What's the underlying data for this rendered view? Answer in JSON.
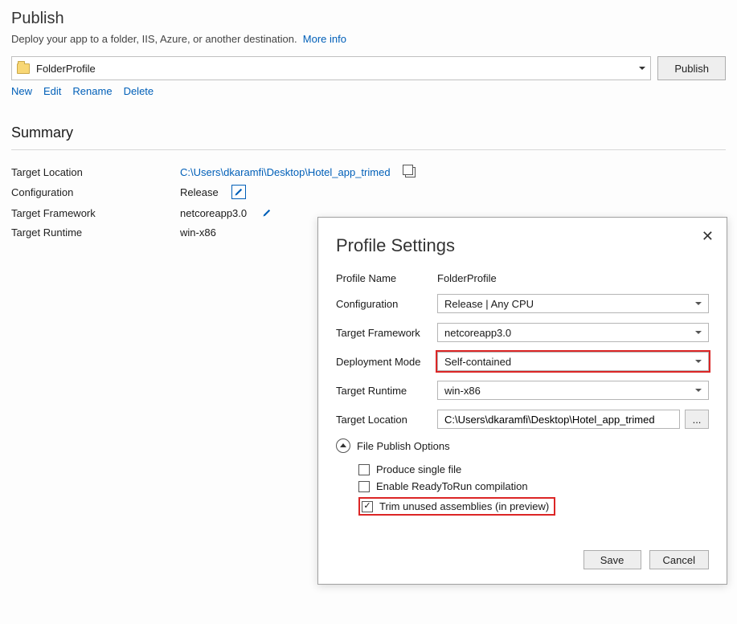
{
  "header": {
    "title": "Publish",
    "subtitle": "Deploy your app to a folder, IIS, Azure, or another destination.",
    "more_info": "More info"
  },
  "profile": {
    "selected": "FolderProfile",
    "publish_button": "Publish",
    "actions": {
      "new": "New",
      "edit": "Edit",
      "rename": "Rename",
      "delete": "Delete"
    }
  },
  "summary": {
    "heading": "Summary",
    "rows": {
      "target_location": {
        "label": "Target Location",
        "value": "C:\\Users\\dkaramfi\\Desktop\\Hotel_app_trimed"
      },
      "configuration": {
        "label": "Configuration",
        "value": "Release"
      },
      "target_framework": {
        "label": "Target Framework",
        "value": "netcoreapp3.0"
      },
      "target_runtime": {
        "label": "Target Runtime",
        "value": "win-x86"
      }
    }
  },
  "modal": {
    "title": "Profile Settings",
    "labels": {
      "profile_name": "Profile Name",
      "configuration": "Configuration",
      "target_framework": "Target Framework",
      "deployment_mode": "Deployment Mode",
      "target_runtime": "Target Runtime",
      "target_location": "Target Location"
    },
    "values": {
      "profile_name": "FolderProfile",
      "configuration": "Release | Any CPU",
      "target_framework": "netcoreapp3.0",
      "deployment_mode": "Self-contained",
      "target_runtime": "win-x86",
      "target_location": "C:\\Users\\dkaramfi\\Desktop\\Hotel_app_trimed"
    },
    "browse": "...",
    "file_publish_options": {
      "heading": "File Publish Options",
      "produce_single_file": "Produce single file",
      "enable_r2r": "Enable ReadyToRun compilation",
      "trim_unused": "Trim unused assemblies (in preview)"
    },
    "buttons": {
      "save": "Save",
      "cancel": "Cancel"
    }
  }
}
